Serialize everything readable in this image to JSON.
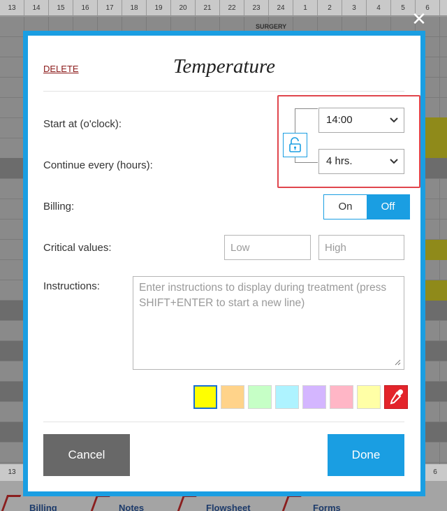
{
  "background": {
    "hours_top": [
      "13",
      "14",
      "15",
      "16",
      "17",
      "18",
      "19",
      "20",
      "21",
      "22",
      "23",
      "24",
      "1",
      "2",
      "3",
      "4",
      "5",
      "6"
    ],
    "section_label": "SURGERY",
    "hours_bottom": [
      "13",
      "6"
    ],
    "tabs": [
      "Billing",
      "Notes",
      "Flowsheet",
      "Forms"
    ]
  },
  "close_glyph": "✕",
  "modal": {
    "delete_label": "DELETE",
    "title": "Temperature",
    "start_label": "Start at (o'clock):",
    "start_value": "14:00",
    "continue_label": "Continue every (hours):",
    "continue_value": "4 hrs.",
    "billing_label": "Billing:",
    "billing_on": "On",
    "billing_off": "Off",
    "billing_selected": "Off",
    "critical_label": "Critical values:",
    "low_placeholder": "Low",
    "high_placeholder": "High",
    "instructions_label": "Instructions:",
    "instructions_placeholder": "Enter instructions to display during treatment (press SHIFT+ENTER to start a new line)",
    "swatch_colors": [
      "#ffff00",
      "#ffd38a",
      "#c6ffc6",
      "#aef3ff",
      "#d4b6ff",
      "#ffb6c6",
      "#ffffa6"
    ],
    "selected_swatch": "#ffff00",
    "picker_icon": "eyedropper-icon",
    "lock_icon": "unlock-icon",
    "cancel_label": "Cancel",
    "done_label": "Done"
  },
  "colors": {
    "accent": "#1a9ee2",
    "highlight": "#e0464d",
    "cancel_bg": "#686868"
  }
}
